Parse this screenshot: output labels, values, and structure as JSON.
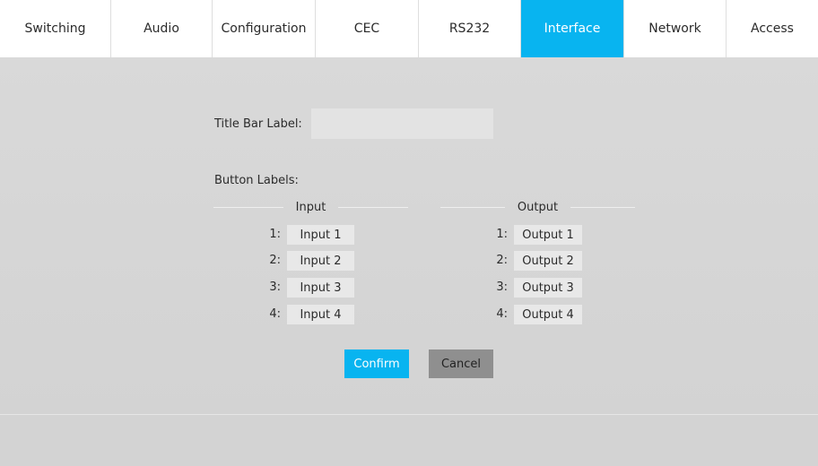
{
  "tabs": [
    {
      "label": "Switching",
      "active": false
    },
    {
      "label": "Audio",
      "active": false
    },
    {
      "label": "Configuration",
      "active": false
    },
    {
      "label": "CEC",
      "active": false
    },
    {
      "label": "RS232",
      "active": false
    },
    {
      "label": "Interface",
      "active": true
    },
    {
      "label": "Network",
      "active": false
    },
    {
      "label": "Access",
      "active": false
    }
  ],
  "interface": {
    "title_bar_label": "Title Bar Label:",
    "title_bar_value": "",
    "button_labels_heading": "Button Labels:",
    "input_heading": "Input",
    "output_heading": "Output",
    "inputs": [
      {
        "num": "1:",
        "value": "Input 1"
      },
      {
        "num": "2:",
        "value": "Input 2"
      },
      {
        "num": "3:",
        "value": "Input 3"
      },
      {
        "num": "4:",
        "value": "Input 4"
      }
    ],
    "outputs": [
      {
        "num": "1:",
        "value": "Output 1"
      },
      {
        "num": "2:",
        "value": "Output 2"
      },
      {
        "num": "3:",
        "value": "Output 3"
      },
      {
        "num": "4:",
        "value": "Output 4"
      }
    ],
    "confirm_label": "Confirm",
    "cancel_label": "Cancel"
  },
  "colors": {
    "accent": "#08b4f0",
    "cancel": "#8f8f8f",
    "background": "#d6d6d6"
  }
}
